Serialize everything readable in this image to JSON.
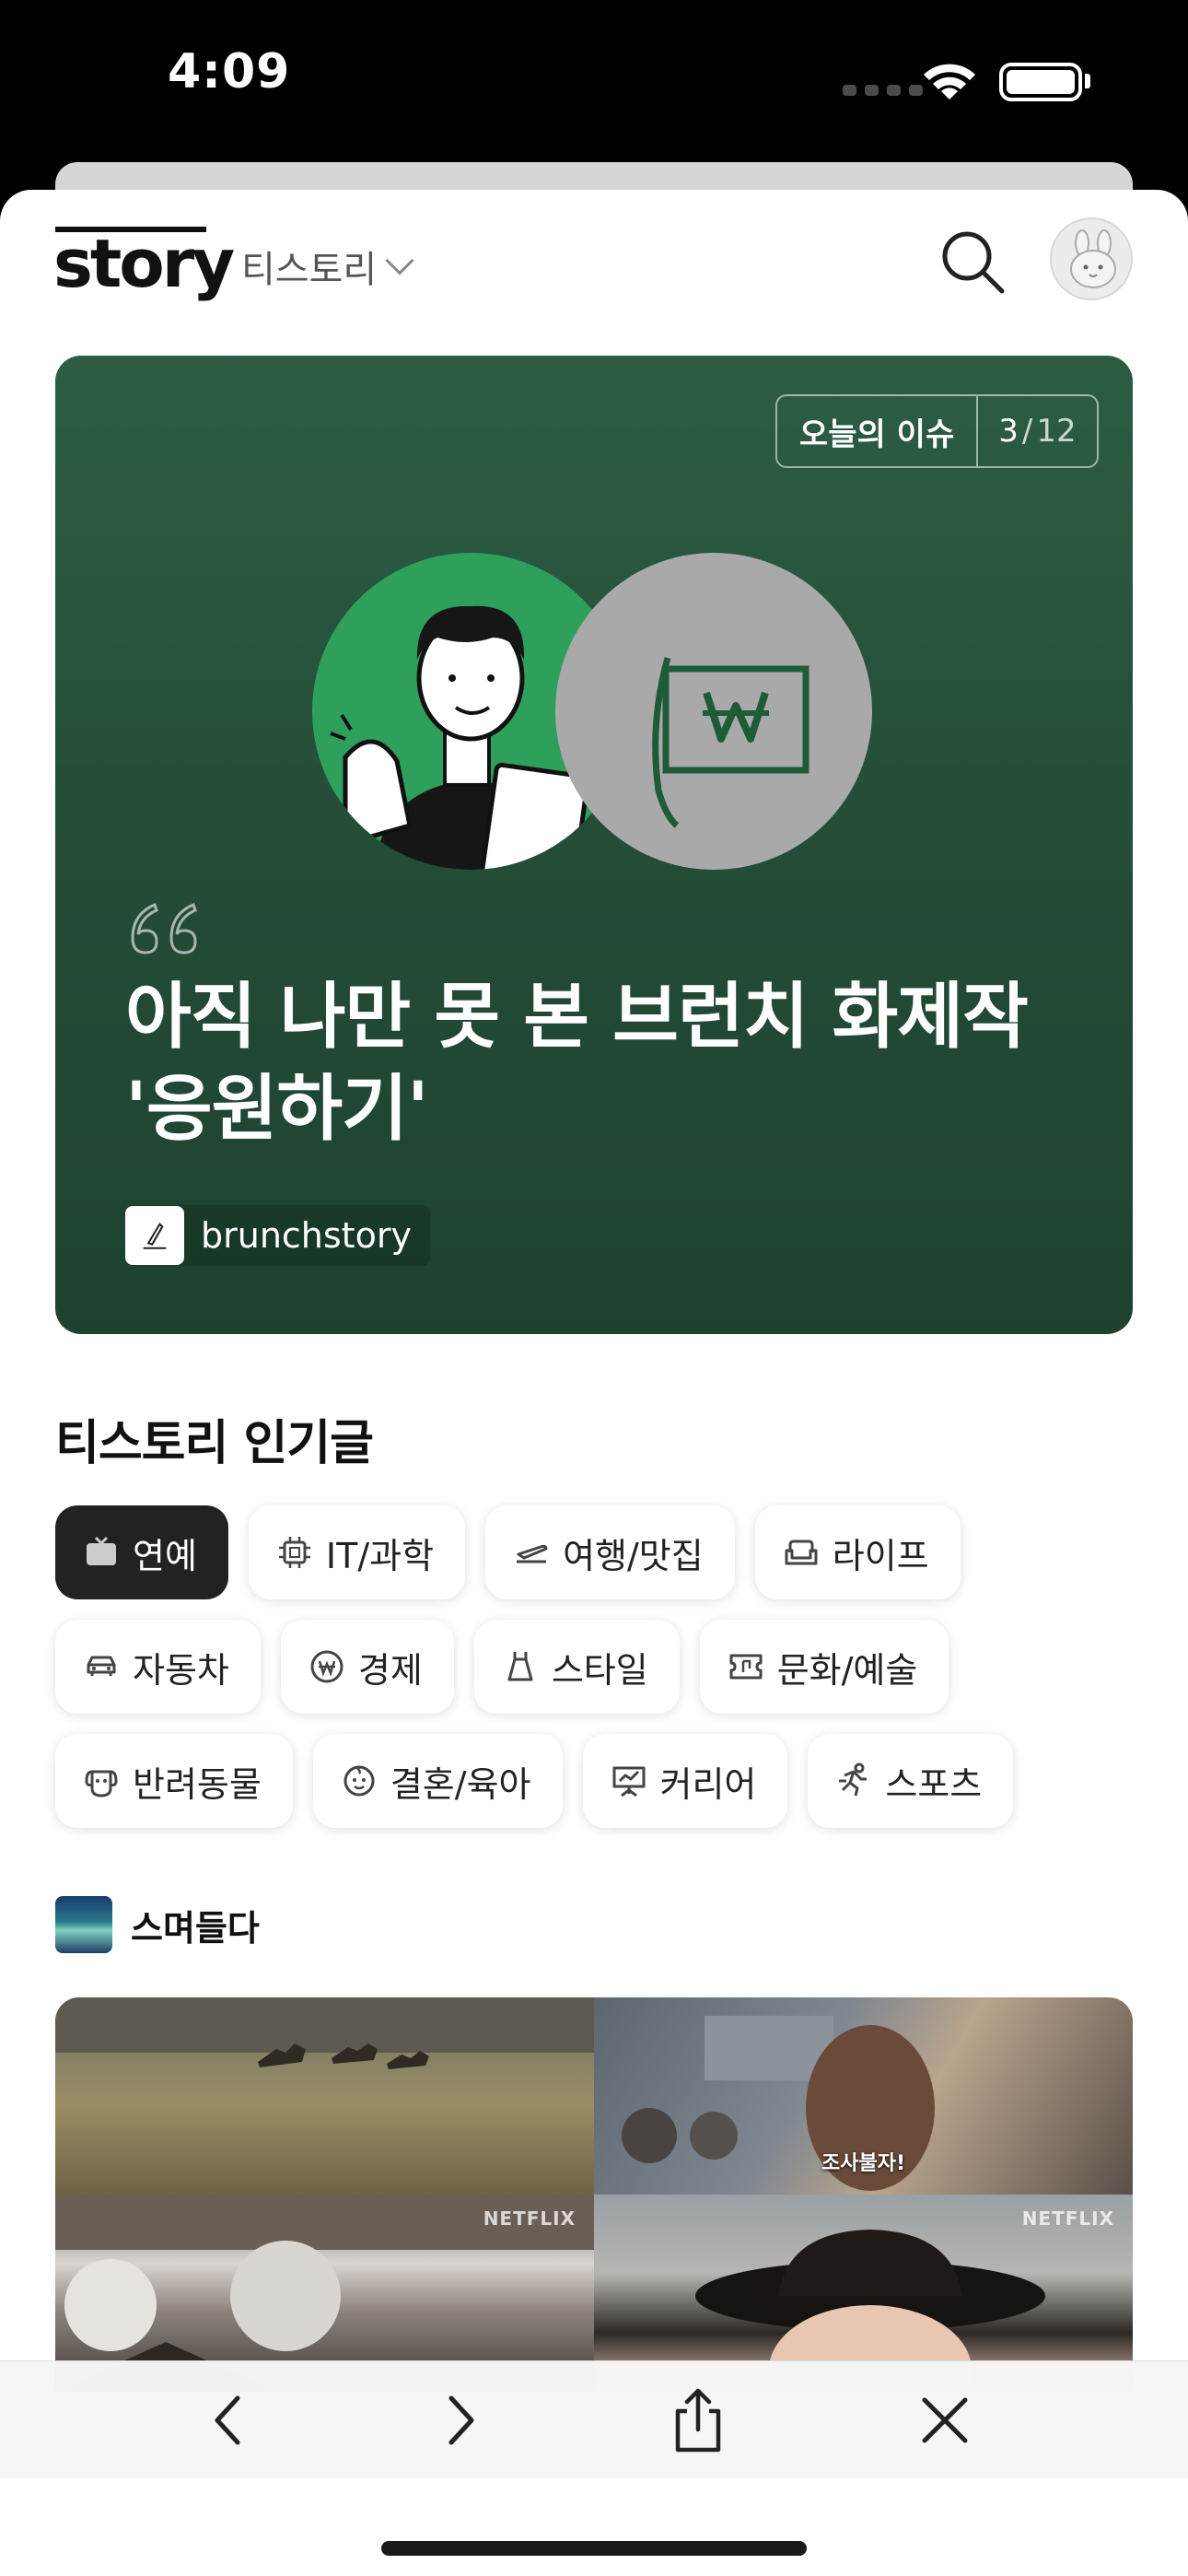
{
  "status": {
    "time": "4:09"
  },
  "header": {
    "logo": "story",
    "service_name": "티스토리"
  },
  "hero": {
    "tag_label": "오늘의 이슈",
    "counter_current": "3",
    "counter_sep": "/",
    "counter_total": "12",
    "title": "아직 나만 못 본 브런치 화제작 '응원하기'",
    "source": "brunchstory",
    "background_color": "#2a5a40"
  },
  "popular": {
    "title": "티스토리 인기글",
    "categories": [
      {
        "label": "연예",
        "icon": "tv-icon",
        "active": true
      },
      {
        "label": "IT/과학",
        "icon": "chip-icon",
        "active": false
      },
      {
        "label": "여행/맛집",
        "icon": "plane-icon",
        "active": false
      },
      {
        "label": "라이프",
        "icon": "sofa-icon",
        "active": false
      },
      {
        "label": "자동차",
        "icon": "car-icon",
        "active": false
      },
      {
        "label": "경제",
        "icon": "won-icon",
        "active": false
      },
      {
        "label": "스타일",
        "icon": "dress-icon",
        "active": false
      },
      {
        "label": "문화/예술",
        "icon": "ticket-icon",
        "active": false
      },
      {
        "label": "반려동물",
        "icon": "dog-icon",
        "active": false
      },
      {
        "label": "결혼/육아",
        "icon": "baby-icon",
        "active": false
      },
      {
        "label": "커리어",
        "icon": "presentation-icon",
        "active": false
      },
      {
        "label": "스포츠",
        "icon": "runner-icon",
        "active": false
      }
    ]
  },
  "post": {
    "blog_name": "스며들다",
    "thumbnails": [
      {
        "watermark": ""
      },
      {
        "watermark": "",
        "caption": "조사불자!"
      },
      {
        "watermark": "NETFLIX"
      },
      {
        "watermark": "NETFLIX"
      }
    ]
  }
}
